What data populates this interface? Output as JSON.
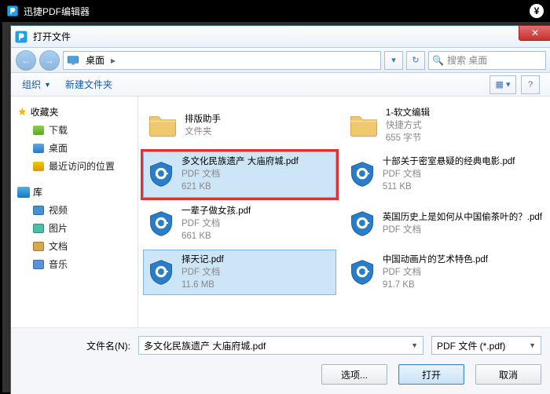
{
  "app": {
    "title": "迅捷PDF编辑器"
  },
  "dialog": {
    "title": "打开文件",
    "breadcrumb": {
      "location": "桌面"
    },
    "search_placeholder": "搜索 桌面",
    "toolbar": {
      "organize": "组织",
      "new_folder": "新建文件夹"
    },
    "sidebar": {
      "favorites": "收藏夹",
      "downloads": "下载",
      "desktop": "桌面",
      "recent": "最近访问的位置",
      "library": "库",
      "video": "视频",
      "pictures": "图片",
      "documents": "文档",
      "music": "音乐"
    },
    "files": [
      {
        "name": "排版助手",
        "type": "文件夹",
        "size": "",
        "kind": "folder"
      },
      {
        "name": "1-软文编辑",
        "type": "快捷方式",
        "size": "655 字节",
        "kind": "shortcut"
      },
      {
        "name": "多文化民族遗产 大庙府城.pdf",
        "type": "PDF 文档",
        "size": "621 KB",
        "kind": "pdf",
        "selected": true,
        "highlight": true
      },
      {
        "name": "十部关于密室悬疑的经典电影.pdf",
        "type": "PDF 文档",
        "size": "511 KB",
        "kind": "pdf"
      },
      {
        "name": "一辈子做女孩.pdf",
        "type": "PDF 文档",
        "size": "661 KB",
        "kind": "pdf"
      },
      {
        "name": "英国历史上是如何从中国偷茶叶的？.pdf",
        "type": "PDF 文档",
        "size": "",
        "kind": "pdf"
      },
      {
        "name": "择天记.pdf",
        "type": "PDF 文档",
        "size": "11.6 MB",
        "kind": "pdf",
        "selected": true
      },
      {
        "name": "中国动画片的艺术特色.pdf",
        "type": "PDF 文档",
        "size": "91.7 KB",
        "kind": "pdf"
      }
    ],
    "footer": {
      "filename_label": "文件名(N):",
      "filename_value": "多文化民族遗产 大庙府城.pdf",
      "filter": "PDF 文件 (*.pdf)",
      "options": "选项...",
      "open": "打开",
      "cancel": "取消"
    }
  }
}
